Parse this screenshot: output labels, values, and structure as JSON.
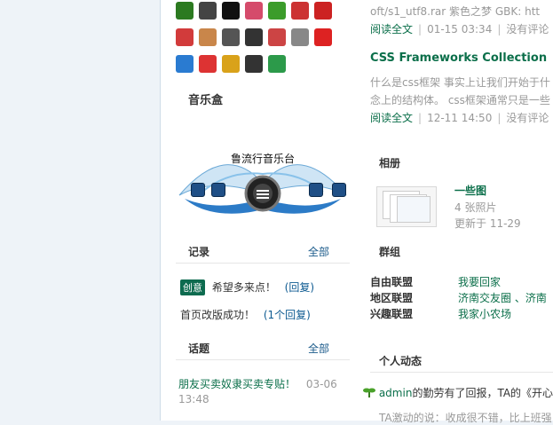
{
  "apps": {
    "row1": [
      {
        "icon": "sprout-icon",
        "color": "#2c7a20"
      },
      {
        "icon": "panda-icon",
        "color": "#444"
      },
      {
        "icon": "mountain-logo-icon",
        "color": "#111"
      },
      {
        "icon": "rabbit-icon",
        "color": "#d54b6b"
      },
      {
        "icon": "leaf-badge-icon",
        "color": "#3b9c2a"
      },
      {
        "icon": "kite-icon",
        "color": "#c33"
      },
      {
        "icon": "fan-icon",
        "color": "#c22"
      }
    ],
    "row2": [
      {
        "icon": "card-icon",
        "color": "#d23b3b"
      },
      {
        "icon": "character-icon",
        "color": "#c9864a"
      },
      {
        "icon": "headphones-icon",
        "color": "#555"
      },
      {
        "icon": "mask-icon",
        "color": "#333"
      },
      {
        "icon": "car-icon",
        "color": "#c44"
      },
      {
        "icon": "gear-tool-icon",
        "color": "#888"
      },
      {
        "icon": "pin-icon",
        "color": "#d22"
      }
    ],
    "row3": [
      {
        "icon": "k-circle-icon",
        "color": "#2a7bd1"
      },
      {
        "icon": "document-icon",
        "color": "#d33"
      },
      {
        "icon": "coins-icon",
        "color": "#d9a21a"
      },
      {
        "icon": "football-icon",
        "color": "#333"
      },
      {
        "icon": "flask-icon",
        "color": "#2c9a4a"
      }
    ]
  },
  "music": {
    "section_title": "音乐盒",
    "station": "鲁流行音乐台"
  },
  "records": {
    "title": "记录",
    "more": "全部",
    "items": [
      {
        "tag": "创意",
        "text": "希望多来点！",
        "reply": "(回复)"
      },
      {
        "text": "首页改版成功！",
        "reply": "(1个回复)"
      }
    ]
  },
  "topics": {
    "title": "话题",
    "more": "全部",
    "items": [
      {
        "text": "朋友买卖奴隶买卖专贴！",
        "date": "03-06",
        "time": "13:48"
      }
    ]
  },
  "blog": {
    "top_line": "oft/s1_utf8.rar 紫色之梦 GBK: htt",
    "post1": {
      "read": "阅读全文",
      "date": "01-15 03:34",
      "comment": "没有评论"
    },
    "post2_title": "CSS Frameworks Collection【css",
    "post2_text1": "什么是css框架 事实上让我们开始于什",
    "post2_text2": "念上的结构体。 css框架通常只是一些",
    "post2": {
      "read": "阅读全文",
      "date": "12-11 14:50",
      "comment": "没有评论"
    }
  },
  "album": {
    "title": "相册",
    "name": "一些图",
    "count": "4 张照片",
    "updated": "更新于  11-29"
  },
  "groups": {
    "title": "群组",
    "rows": [
      {
        "label": "自由联盟",
        "value": "我要回家"
      },
      {
        "label": "地区联盟",
        "value": "济南交友圈 、济南"
      },
      {
        "label": "兴趣联盟",
        "value": "我家小农场"
      }
    ]
  },
  "feed": {
    "title": "个人动态",
    "item1_user": "admin",
    "item1_text": "的勤劳有了回报，TA的《开心",
    "item2_text": "TA激动的说：收成很不错，比上班强"
  }
}
